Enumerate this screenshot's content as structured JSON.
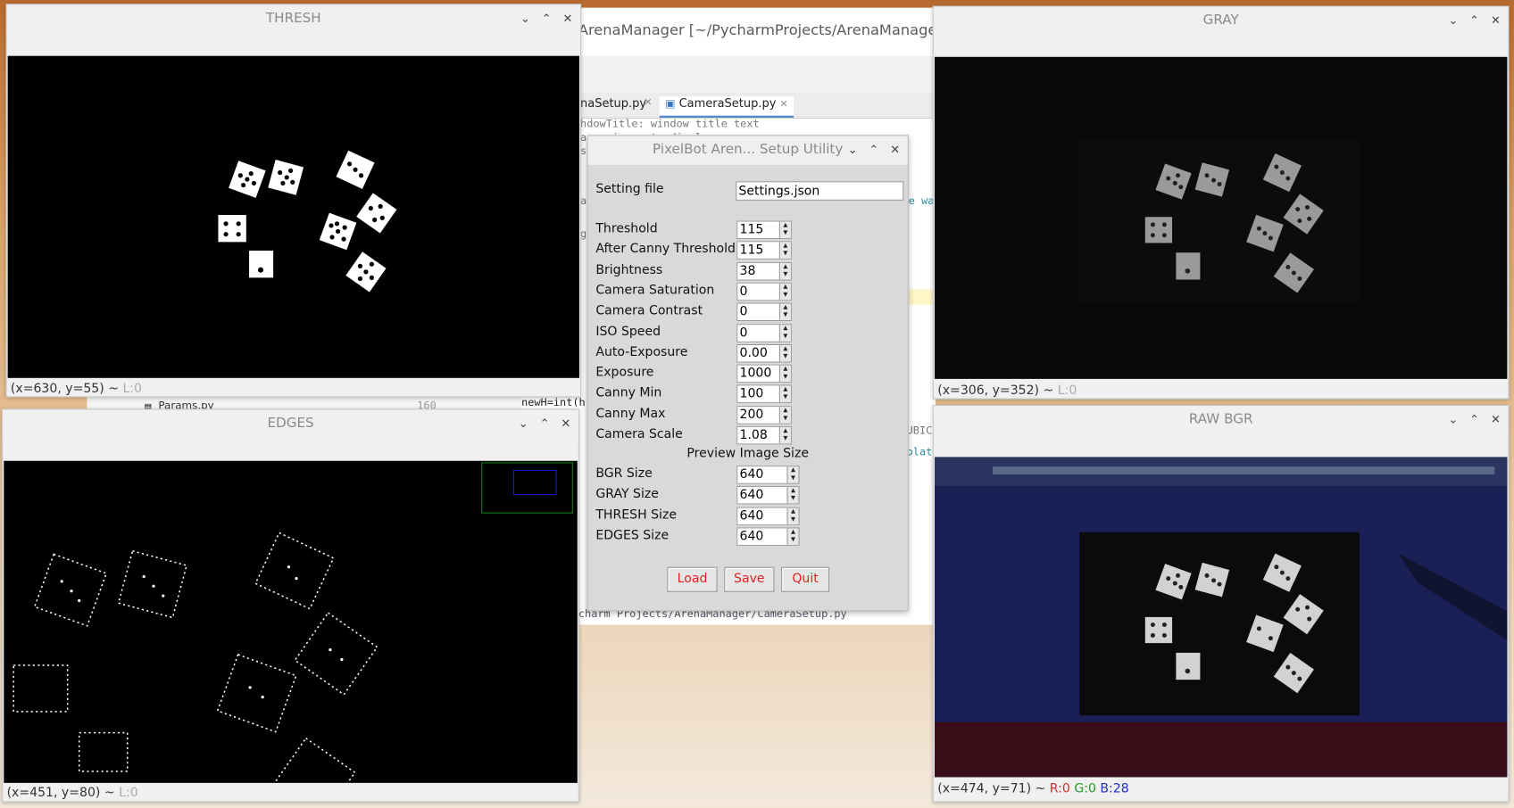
{
  "ide": {
    "title": "ArenaManager [~/PycharmProjects/ArenaManager] - .../C",
    "tabs": [
      "naSetup.py",
      "CameraSetup.py"
    ],
    "code_lines": [
      "hdowTitle: window title text",
      "age: image to display",
      "s",
      "ac",
      "g",
      "e was",
      "newH=int(h",
      "UBIC",
      "olati",
      "charm Projects/ArenaManager/CameraSetup.py"
    ],
    "lower_file": "Params.py",
    "lower_line": "160"
  },
  "windows": {
    "thresh": {
      "title": "THRESH",
      "status": "(x=630, y=55) ~ ",
      "status_tail": "L:0"
    },
    "edges": {
      "title": "EDGES",
      "status": "(x=451, y=80) ~ ",
      "status_tail": "L:0"
    },
    "gray": {
      "title": "GRAY",
      "status": "(x=306, y=352) ~ ",
      "status_tail": "L:0"
    },
    "raw": {
      "title": "RAW BGR",
      "status": "(x=474, y=71) ~ ",
      "r": "R:0",
      "g": "G:0",
      "b": "B:28"
    }
  },
  "controls": {
    "minimize": "⌄",
    "maximize": "⌃",
    "close": "✕"
  },
  "dialog": {
    "title": "PixelBot Aren... Setup Utility",
    "setting_file_label": "Setting file",
    "setting_file_value": "Settings.json",
    "params": [
      {
        "label": "Threshold",
        "value": "115"
      },
      {
        "label": "After Canny Threshold",
        "value": "115"
      },
      {
        "label": "Brightness",
        "value": "38"
      },
      {
        "label": "Camera Saturation",
        "value": "0"
      },
      {
        "label": "Camera Contrast",
        "value": "0"
      },
      {
        "label": "ISO Speed",
        "value": "0"
      },
      {
        "label": "Auto-Exposure",
        "value": "0.00"
      },
      {
        "label": "Exposure",
        "value": "1000"
      },
      {
        "label": "Canny Min",
        "value": "100"
      },
      {
        "label": "Canny Max",
        "value": "200"
      },
      {
        "label": "Camera Scale",
        "value": "1.08"
      }
    ],
    "preview_header": "Preview Image Size",
    "sizes": [
      {
        "label": "BGR Size",
        "value": "640"
      },
      {
        "label": "GRAY Size",
        "value": "640"
      },
      {
        "label": "THRESH Size",
        "value": "640"
      },
      {
        "label": "EDGES Size",
        "value": "640"
      }
    ],
    "buttons": {
      "load": "Load",
      "save": "Save",
      "quit": "Quit"
    }
  },
  "colors": {
    "button_text": "#d22222",
    "r_color": "#d03030",
    "g_color": "#2a9a2a",
    "b_color": "#2030c0"
  }
}
